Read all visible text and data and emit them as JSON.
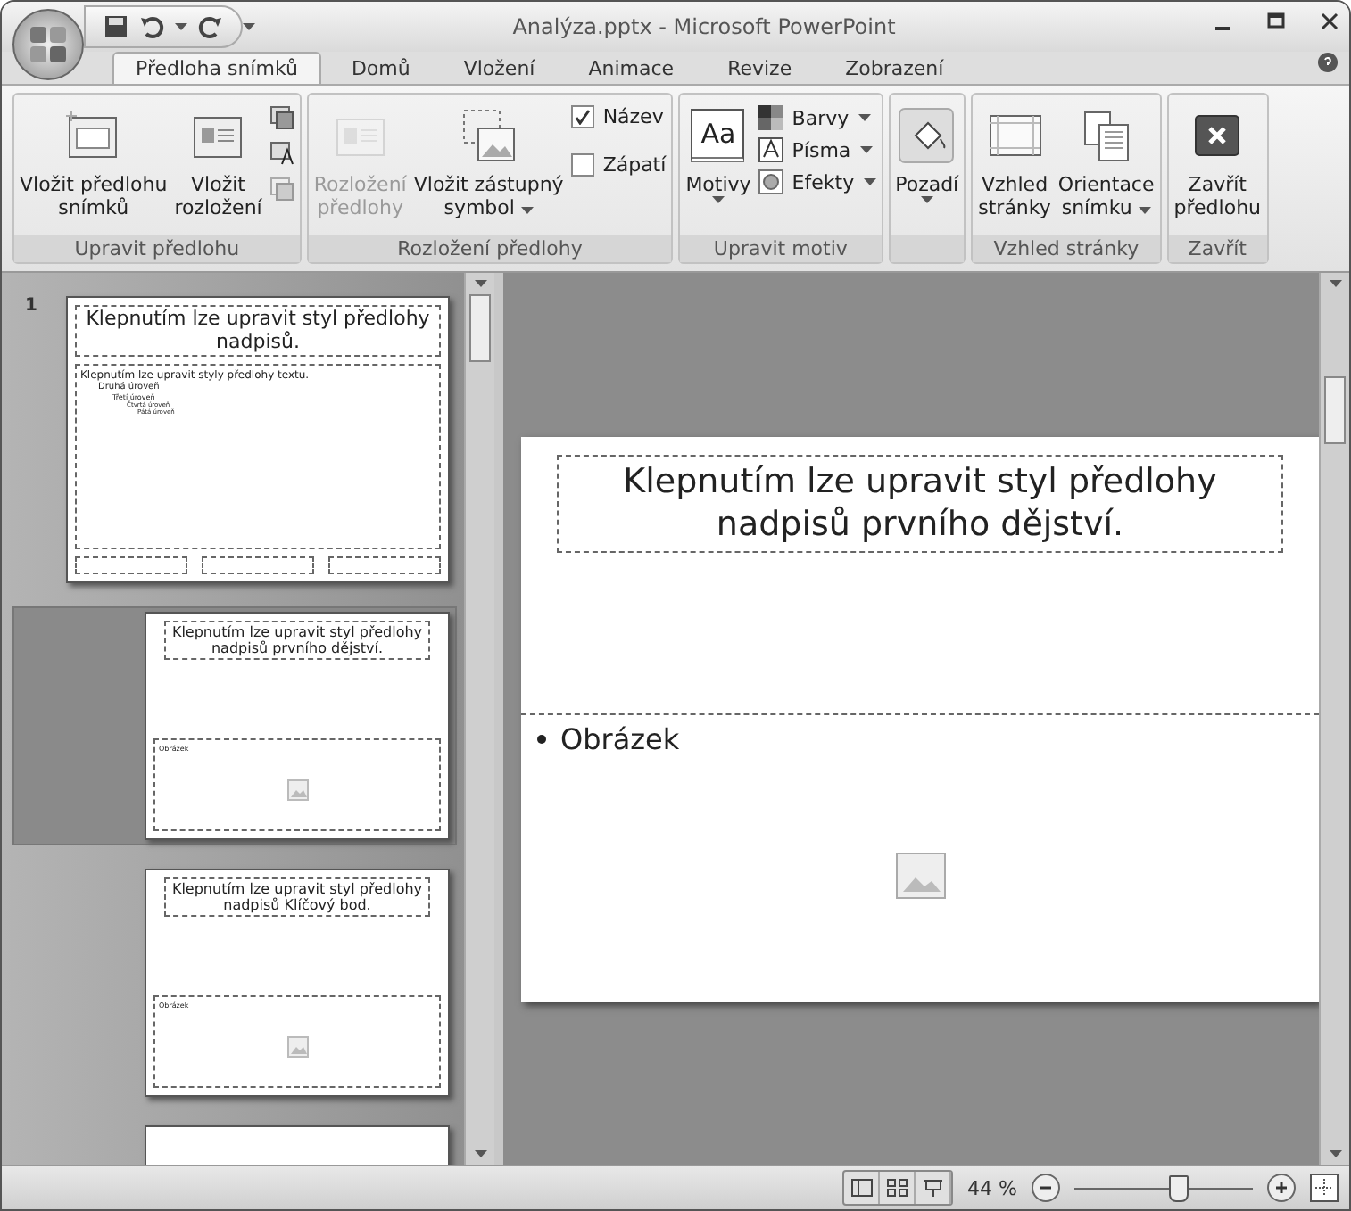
{
  "window": {
    "title": "Analýza.pptx - Microsoft PowerPoint"
  },
  "tabs": [
    {
      "label": "Předloha snímků",
      "selected": true
    },
    {
      "label": "Domů",
      "selected": false
    },
    {
      "label": "Vložení",
      "selected": false
    },
    {
      "label": "Animace",
      "selected": false
    },
    {
      "label": "Revize",
      "selected": false
    },
    {
      "label": "Zobrazení",
      "selected": false
    }
  ],
  "ribbon": [
    {
      "label": "Upravit předlohu",
      "items": [
        {
          "kind": "large",
          "lines": [
            "Vložit předlohu",
            "snímků"
          ]
        },
        {
          "kind": "large",
          "lines": [
            "Vložit",
            "rozložení"
          ]
        },
        {
          "kind": "icons"
        }
      ]
    },
    {
      "label": "Rozložení předlohy",
      "items": [
        {
          "kind": "large",
          "lines": [
            "Rozložení",
            "předlohy"
          ],
          "disabled": true
        },
        {
          "kind": "large",
          "lines": [
            "Vložit zástupný",
            "symbol"
          ],
          "dropdown": true
        },
        {
          "kind": "checks",
          "checks": [
            {
              "label": "Název",
              "checked": true
            },
            {
              "label": "Zápatí",
              "checked": false
            }
          ]
        }
      ]
    },
    {
      "label": "Upravit motiv",
      "items": [
        {
          "kind": "large",
          "lines": [
            "Motivy"
          ],
          "sample": "Aa",
          "dropdown": true
        },
        {
          "kind": "smalls",
          "smalls": [
            {
              "label": "Barvy"
            },
            {
              "label": "Písma"
            },
            {
              "label": "Efekty"
            }
          ]
        }
      ]
    },
    {
      "items": [
        {
          "kind": "large",
          "lines": [
            "Pozadí"
          ],
          "dropdown": true
        }
      ]
    },
    {
      "label": "Vzhled stránky",
      "items": [
        {
          "kind": "large",
          "lines": [
            "Vzhled",
            "stránky"
          ]
        },
        {
          "kind": "large",
          "lines": [
            "Orientace",
            "snímku"
          ],
          "dropdown": true
        }
      ]
    },
    {
      "label": "Zavřít",
      "items": [
        {
          "kind": "large",
          "lines": [
            "Zavřít",
            "předlohu"
          ]
        }
      ]
    }
  ],
  "thumbnails": [
    {
      "kind": "master",
      "number": "1",
      "title": "Klepnutím lze upravit styl předlohy nadpisů.",
      "body": [
        "Klepnutím lze upravit styly předlohy textu.",
        "Druhá úroveň",
        "Třetí úroveň",
        "Čtvrtá úroveň",
        "Pátá úroveň"
      ],
      "selected": false
    },
    {
      "kind": "layout",
      "title": "Klepnutím  lze upravit styl předlohy nadpisů prvního dějství.",
      "body": [
        "Obrázek"
      ],
      "selected": true
    },
    {
      "kind": "layout",
      "title": "Klepnutím  lze upravit styl předlohy nadpisů Klíčový bod.",
      "body": [
        "Obrázek"
      ],
      "selected": false
    },
    {
      "kind": "blank",
      "selected": false
    }
  ],
  "slide": {
    "title": "Klepnutím lze upravit styl předlohy nadpisů prvního dějství.",
    "bullet": "Obrázek"
  },
  "status_bar": {
    "zoom": "44 %",
    "zoom_slider": {
      "level": 0.58
    }
  }
}
